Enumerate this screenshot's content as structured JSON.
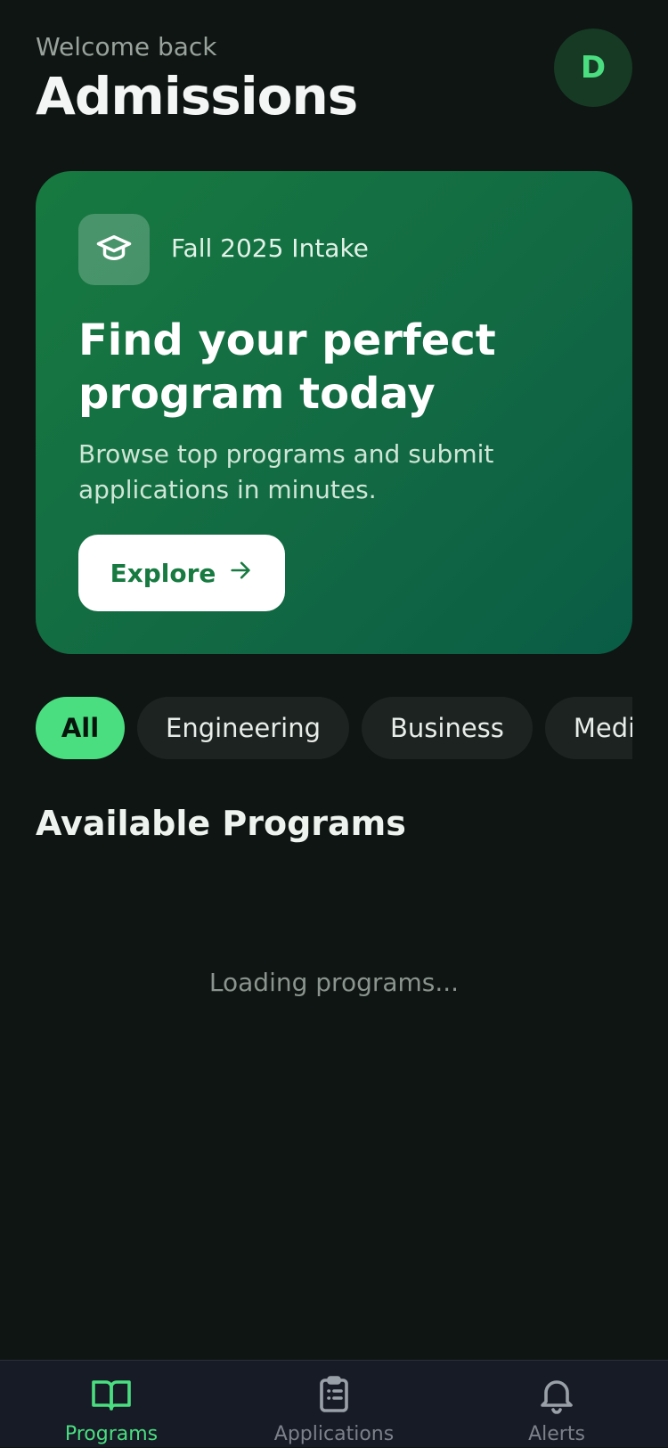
{
  "header": {
    "welcome": "Welcome back",
    "title": "Admissions",
    "avatar_initial": "D"
  },
  "hero": {
    "icon": "graduation-cap-icon",
    "tag": "Fall 2025 Intake",
    "title": "Find your perfect program today",
    "subtitle": "Browse top programs and submit applications in minutes.",
    "button_label": "Explore",
    "button_icon": "arrow-right-icon"
  },
  "filters": {
    "selected": "All",
    "chips": [
      "All",
      "Engineering",
      "Business",
      "Medical"
    ]
  },
  "programs": {
    "section_title": "Available Programs",
    "loading_text": "Loading programs..."
  },
  "tabbar": {
    "items": [
      {
        "label": "Programs",
        "icon": "book-open-icon",
        "active": true
      },
      {
        "label": "Applications",
        "icon": "clipboard-icon",
        "active": false
      },
      {
        "label": "Alerts",
        "icon": "bell-icon",
        "active": false
      }
    ]
  },
  "colors": {
    "background": "#0e1512",
    "accent": "#4ade80",
    "hero_gradient_start": "#177a40",
    "hero_gradient_end": "#0a5c45",
    "tabbar": "#171b26"
  }
}
